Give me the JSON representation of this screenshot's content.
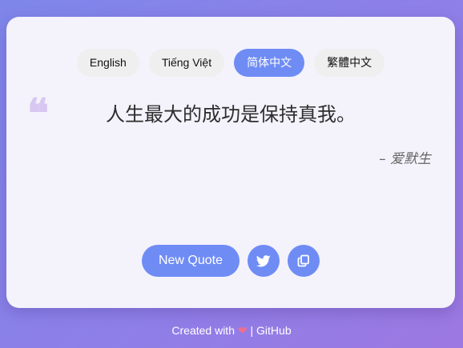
{
  "languages": [
    {
      "label": "English",
      "active": false
    },
    {
      "label": "Tiếng Việt",
      "active": false
    },
    {
      "label": "简体中文",
      "active": true
    },
    {
      "label": "繁體中文",
      "active": false
    }
  ],
  "quote": {
    "mark": "❝",
    "text": "人生最大的成功是保持真我。",
    "author": "– 爱默生"
  },
  "actions": {
    "new_quote_label": "New Quote",
    "twitter_icon": "twitter-icon",
    "copy_icon": "copy-icon"
  },
  "footer": {
    "created_with": "Created with",
    "heart": "❤",
    "separator": "|",
    "link_label": "GitHub"
  },
  "colors": {
    "accent": "#6f8cf5",
    "card_bg": "#f4f2fb",
    "quote_mark": "#d7c7f1",
    "heart": "#f06e8e"
  }
}
